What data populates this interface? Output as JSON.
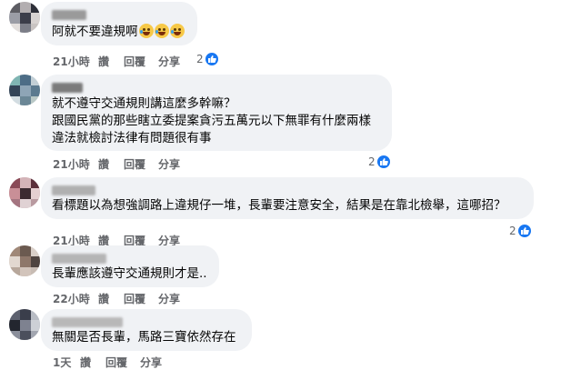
{
  "actions": {
    "like": "讚",
    "reply": "回覆",
    "share": "分享"
  },
  "comments": [
    {
      "lines": [
        "阿就不要違規啊"
      ],
      "emoji_suffix": [
        "rolling-laughing-emoji",
        "rolling-laughing-emoji",
        "rolling-laughing-emoji"
      ],
      "time": "21小時",
      "reactions": "2"
    },
    {
      "lines": [
        "就不遵守交通規則講這麼多幹嘛？",
        "跟國民黨的那些瞎立委提案貪污五萬元以下無罪有什麼兩樣",
        "違法就檢討法律有問題很有事"
      ],
      "time": "21小時",
      "reactions": "2"
    },
    {
      "lines": [
        "看標題以為想強調路上違規仔一堆，長輩要注意安全，結果是在靠北檢舉，這哪招？"
      ],
      "time": "21小時",
      "reactions": "2"
    },
    {
      "lines": [
        "長輩應該遵守交通規則才是.."
      ],
      "time": "22小時"
    },
    {
      "lines": [
        "無關是否長輩，馬路三寶依然存在"
      ],
      "time": "1天"
    }
  ],
  "colors": {
    "bubble": "#f0f2f5",
    "like_blue": "#1877f2",
    "meta_gray": "#65676b"
  }
}
